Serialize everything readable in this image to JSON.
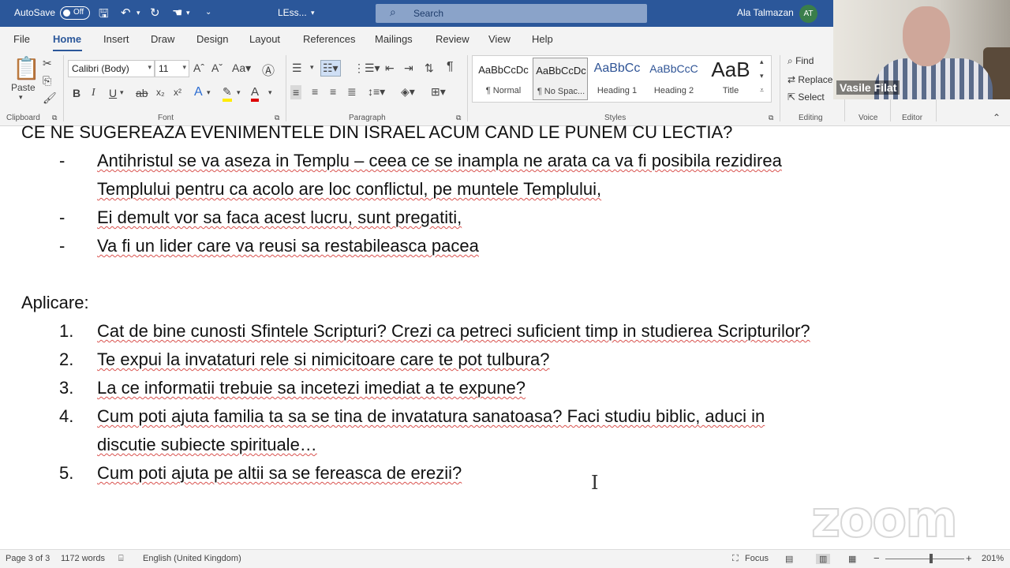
{
  "titlebar": {
    "autosave_label": "AutoSave",
    "autosave_state": "Off",
    "doc_name": "LEss...",
    "search_placeholder": "Search",
    "user_name": "Ala Talmazan",
    "user_initials": "AT"
  },
  "tabs": [
    "File",
    "Home",
    "Insert",
    "Draw",
    "Design",
    "Layout",
    "References",
    "Mailings",
    "Review",
    "View",
    "Help"
  ],
  "active_tab": "Home",
  "ribbon": {
    "clipboard": {
      "label": "Clipboard",
      "paste": "Paste"
    },
    "font": {
      "label": "Font",
      "name": "Calibri (Body)",
      "size": "11"
    },
    "paragraph": {
      "label": "Paragraph"
    },
    "styles": {
      "label": "Styles",
      "items": [
        {
          "preview": "AaBbCcDc",
          "name": "¶ Normal"
        },
        {
          "preview": "AaBbCcDc",
          "name": "¶ No Spac..."
        },
        {
          "preview": "AaBbCc",
          "name": "Heading 1"
        },
        {
          "preview": "AaBbCcC",
          "name": "Heading 2"
        },
        {
          "preview": "AaB",
          "name": "Title"
        }
      ]
    },
    "editing": {
      "label": "Editing",
      "find": "Find",
      "replace": "Replace",
      "select": "Select"
    },
    "voice": {
      "label": "Voice"
    },
    "editor": {
      "label": "Editor"
    }
  },
  "document": {
    "heading_line": "CE NE SUGEREAZA EVENIMENTELE DIN ISRAEL ACUM CAND LE PUNEM CU LECTIA?",
    "bullets": [
      {
        "marker": "-",
        "lines": [
          "Antihristul se va aseza in Templu – ceea ce se inampla ne arata ca va fi posibila rezidirea",
          "Templului pentru ca acolo are loc conflictul, pe muntele Templului,"
        ]
      },
      {
        "marker": "-",
        "lines": [
          "Ei demult vor sa faca acest lucru, sunt pregatiti,"
        ]
      },
      {
        "marker": "-",
        "lines": [
          "Va fi un lider care va reusi sa restabileasca pacea"
        ]
      }
    ],
    "section_title": "Aplicare:",
    "numbered": [
      {
        "marker": "1.",
        "lines": [
          "Cat de bine cunosti Sfintele Scripturi? Crezi ca petreci suficient timp in studierea Scripturilor?"
        ]
      },
      {
        "marker": "2.",
        "lines": [
          "Te expui la invataturi rele si nimicitoare care te pot tulbura?"
        ]
      },
      {
        "marker": "3.",
        "lines": [
          "La ce informatii trebuie sa incetezi imediat a te expune?"
        ]
      },
      {
        "marker": "4.",
        "lines": [
          "Cum poti ajuta familia ta sa se tina de invatatura sanatoasa? Faci studiu biblic, aduci in",
          "discutie subiecte spirituale…"
        ]
      },
      {
        "marker": "5.",
        "lines": [
          "Cum poti ajuta pe altii sa se fereasca de erezii?"
        ]
      }
    ]
  },
  "watermark": "zoom",
  "video": {
    "participant_name": "Vasile Filat"
  },
  "statusbar": {
    "page": "Page 3 of 3",
    "words": "1172 words",
    "language": "English (United Kingdom)",
    "focus": "Focus",
    "zoom_minus": "−",
    "zoom_plus": "+",
    "zoom": "201%"
  },
  "colors": {
    "titlebar": "#2b579a",
    "spellcheck": "#d9534f"
  }
}
